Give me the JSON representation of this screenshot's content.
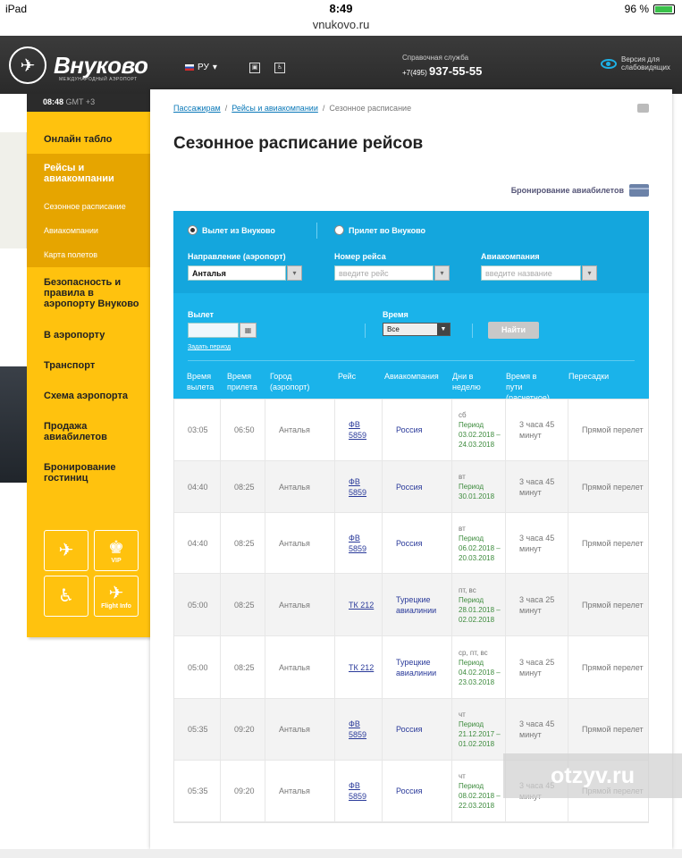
{
  "statusbar": {
    "device": "iPad",
    "time": "8:49",
    "battery": "96 %"
  },
  "url": "vnukovo.ru",
  "header": {
    "logo": "Внуково",
    "logo_sub": "МЕЖДУНАРОДНЫЙ АЭРОПОРТ",
    "lang": "РУ",
    "helpdesk": "Справочная служба",
    "phone_prefix": "+7(495)",
    "phone": "937-55-55",
    "vision_line1": "Версия для",
    "vision_line2": "слабовидящих"
  },
  "sidebar": {
    "time": "08:48",
    "tz": "GMT +3",
    "items": [
      {
        "label": "Онлайн табло"
      },
      {
        "label": "Рейсы и авиакомпании"
      },
      {
        "label": "Безопасность и правила в аэропорту Внуково"
      },
      {
        "label": "В аэропорту"
      },
      {
        "label": "Транспорт"
      },
      {
        "label": "Схема аэропорта"
      },
      {
        "label": "Продажа авиабилетов"
      },
      {
        "label": "Бронирование гостиниц"
      }
    ],
    "subitems": [
      "Сезонное расписание",
      "Авиакомпании",
      "Карта полетов"
    ],
    "tiles": [
      "",
      "VIP",
      "",
      "Flight Info"
    ]
  },
  "breadcrumbs": [
    "Пассажирам",
    "Рейсы и авиакомпании",
    "Сезонное расписание"
  ],
  "page_title": "Сезонное расписание рейсов",
  "booking_link": "Бронирование авиабилетов",
  "search": {
    "radio_departure": "Вылет из Внуково",
    "radio_arrival": "Прилет во Внуково",
    "direction_label": "Направление (аэропорт)",
    "direction_value": "Анталья",
    "flight_label": "Номер рейса",
    "flight_placeholder": "введите рейс",
    "airline_label": "Авиакомпания",
    "airline_placeholder": "введите название",
    "departure_label": "Вылет",
    "date_range_link": "Задать период",
    "time_label": "Время",
    "time_value": "Все",
    "find_button": "Найти"
  },
  "table": {
    "headers": [
      "Время вылета",
      "Время прилета",
      "Город (аэропорт)",
      "Рейс",
      "Авиакомпания",
      "Дни в неделю",
      "Время в пути (расчетное)",
      "Пересадки"
    ],
    "rows": [
      {
        "dep": "03:05",
        "arr": "06:50",
        "city": "Анталья",
        "flight": "ФВ 5859",
        "airline": "Россия",
        "days": "сб",
        "period_label": "Период",
        "period": "03.02.2018 – 24.03.2018",
        "duration": "3 часа 45 минут",
        "transfer": "Прямой перелет"
      },
      {
        "dep": "04:40",
        "arr": "08:25",
        "city": "Анталья",
        "flight": "ФВ 5859",
        "airline": "Россия",
        "days": "вт",
        "period_label": "Период",
        "period": "30.01.2018",
        "duration": "3 часа 45 минут",
        "transfer": "Прямой перелет"
      },
      {
        "dep": "04:40",
        "arr": "08:25",
        "city": "Анталья",
        "flight": "ФВ 5859",
        "airline": "Россия",
        "days": "вт",
        "period_label": "Период",
        "period": "06.02.2018 – 20.03.2018",
        "duration": "3 часа 45 минут",
        "transfer": "Прямой перелет"
      },
      {
        "dep": "05:00",
        "arr": "08:25",
        "city": "Анталья",
        "flight": "ТК 212",
        "airline": "Турецкие авиалинии",
        "days": "пт, вс",
        "period_label": "Период",
        "period": "28.01.2018 – 02.02.2018",
        "duration": "3 часа 25 минут",
        "transfer": "Прямой перелет"
      },
      {
        "dep": "05:00",
        "arr": "08:25",
        "city": "Анталья",
        "flight": "ТК 212",
        "airline": "Турецкие авиалинии",
        "days": "ср, пт, вс",
        "period_label": "Период",
        "period": "04.02.2018 – 23.03.2018",
        "duration": "3 часа 25 минут",
        "transfer": "Прямой перелет"
      },
      {
        "dep": "05:35",
        "arr": "09:20",
        "city": "Анталья",
        "flight": "ФВ 5859",
        "airline": "Россия",
        "days": "чт",
        "period_label": "Период",
        "period": "21.12.2017 – 01.02.2018",
        "duration": "3 часа 45 минут",
        "transfer": "Прямой перелет"
      },
      {
        "dep": "05:35",
        "arr": "09:20",
        "city": "Анталья",
        "flight": "ФВ 5859",
        "airline": "Россия",
        "days": "чт",
        "period_label": "Период",
        "period": "08.02.2018 – 22.03.2018",
        "duration": "3 часа 45 минут",
        "transfer": "Прямой перелет"
      }
    ]
  },
  "watermark": "otzyv.ru",
  "colors": {
    "panel": "#14a6dd",
    "sidebar": "#ffc20e",
    "sidebar_active": "#e6a500",
    "link": "#0a78b8"
  }
}
